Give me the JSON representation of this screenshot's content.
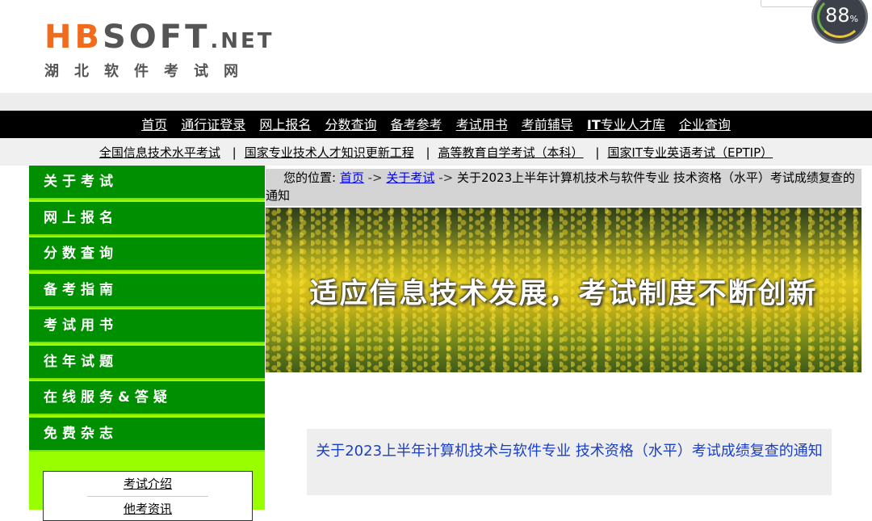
{
  "logo": {
    "hb": "HB",
    "soft": "SOFT",
    "net": ".NET",
    "subtitle": "湖北软件考试网"
  },
  "speed_widget": {
    "value": "88",
    "unit": "%"
  },
  "main_nav": [
    {
      "label": "首页"
    },
    {
      "label": "通行证登录"
    },
    {
      "label": "网上报名"
    },
    {
      "label": "分数查询"
    },
    {
      "label": "备考参考"
    },
    {
      "label": "考试用书"
    },
    {
      "label": "考前辅导"
    },
    {
      "label_bold": "IT",
      "label": "专业人才库"
    },
    {
      "label": "企业查询"
    }
  ],
  "sub_nav": [
    "全国信息技术水平考试",
    "国家专业技术人才知识更新工程",
    "高等教育自学考试（本科）",
    "国家IT专业英语考试（EPTIP）"
  ],
  "sub_nav_separator": "|",
  "sidebar": {
    "items": [
      "关于考试",
      "网上报名",
      "分数查询",
      "备考指南",
      "考试用书",
      "往年试题",
      "在线服务&答疑",
      "免费杂志"
    ],
    "box_links": [
      "考试介绍",
      "他考资讯"
    ]
  },
  "breadcrumb": {
    "prefix": "您的位置:",
    "home": "首页",
    "arrow": "->",
    "section": "关于考试",
    "current": "关于2023上半年计算机技术与软件专业 技术资格（水平）考试成绩复查的通知"
  },
  "banner": {
    "text": "适应信息技术发展，考试制度不断创新"
  },
  "article": {
    "title": "关于2023上半年计算机技术与软件专业 技术资格（水平）考试成绩复查的通知"
  },
  "colors": {
    "sidebar_item": "#008f00",
    "sidebar_bg": "#99ff00",
    "nav_bg": "#000000",
    "logo_orange": "#f26a1b",
    "title_blue": "#1a3fc8"
  }
}
